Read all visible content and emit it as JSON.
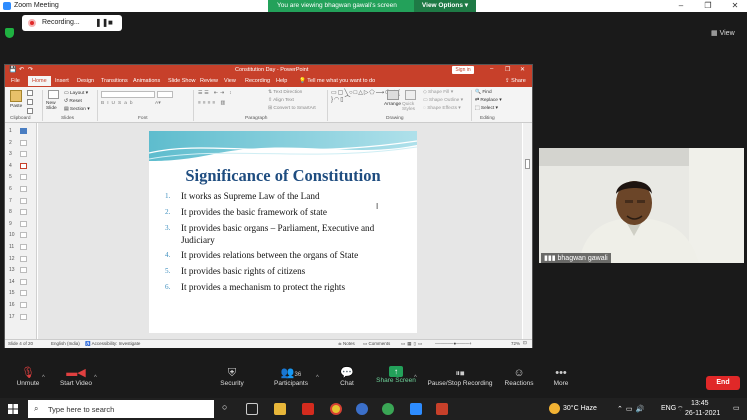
{
  "window": {
    "title": "Zoom Meeting"
  },
  "recording": {
    "label": "Recording...",
    "pause_icon": "pause-icon",
    "stop_icon": "stop-icon"
  },
  "share_banner": {
    "text": "You are viewing bhagwan gawali's screen",
    "view_options": "View Options"
  },
  "view_button": "View",
  "ppt": {
    "title": "Constitution Day  -  PowerPoint",
    "signin": "Sign in",
    "tabs": [
      "File",
      "Home",
      "Insert",
      "Design",
      "Transitions",
      "Animations",
      "Slide Show",
      "Review",
      "View",
      "Recording",
      "Help",
      "Tell me what you want to do",
      "Share"
    ],
    "ribbon": {
      "clipboard": "Clipboard",
      "paste": "Paste",
      "slides": "Slides",
      "new_slide": "New Slide",
      "layout": "Layout",
      "reset": "Reset",
      "section": "Section",
      "font": "Font",
      "paragraph": "Paragraph",
      "text_direction": "Text Direction",
      "align_text": "Align Text",
      "convert_smartart": "Convert to SmartArt",
      "drawing": "Drawing",
      "arrange": "Arrange",
      "quick_styles": "Quick Styles",
      "shape_fill": "Shape Fill",
      "shape_outline": "Shape Outline",
      "shape_effects": "Shape Effects",
      "editing": "Editing",
      "find": "Find",
      "replace": "Replace",
      "select": "Select"
    },
    "thumb_numbers": [
      "1",
      "2",
      "3",
      "4",
      "5",
      "6",
      "7",
      "8",
      "9",
      "10",
      "11",
      "12",
      "13",
      "14",
      "15",
      "16",
      "17"
    ],
    "status": {
      "slide": "Slide 4 of 20",
      "language": "English (India)",
      "accessibility": "Accessibility: Investigate",
      "notes": "Notes",
      "comments": "Comments",
      "zoom": "72%"
    },
    "slide": {
      "title": "Significance of Constitution",
      "points": [
        {
          "num": "1.",
          "text": "It works as Supreme Law of the Land"
        },
        {
          "num": "2.",
          "text": "It provides the basic framework of state"
        },
        {
          "num": "3.",
          "text": "It provides basic organs – Parliament, Executive and Judiciary"
        },
        {
          "num": "4.",
          "text": "It provides relations between the organs of State"
        },
        {
          "num": "5.",
          "text": "It provides basic rights of citizens"
        },
        {
          "num": "6.",
          "text": "It provides a mechanism to protect the rights"
        }
      ]
    }
  },
  "video": {
    "name": "bhagwan gawali"
  },
  "toolbar": {
    "unmute": "Unmute",
    "start_video": "Start Video",
    "security": "Security",
    "participants": "Participants",
    "participants_count": "36",
    "chat": "Chat",
    "share_screen": "Share Screen",
    "pause_recording": "Pause/Stop Recording",
    "reactions": "Reactions",
    "more": "More",
    "end": "End"
  },
  "taskbar": {
    "search_placeholder": "Type here to search",
    "weather": "30°C  Haze",
    "lang": "ENG",
    "time": "13:45",
    "date": "26-11-2021"
  },
  "colors": {
    "ppt_accent": "#c7402a",
    "zoom_green": "#23a15a",
    "end_red": "#e02828",
    "slide_title": "#1f4d80"
  }
}
